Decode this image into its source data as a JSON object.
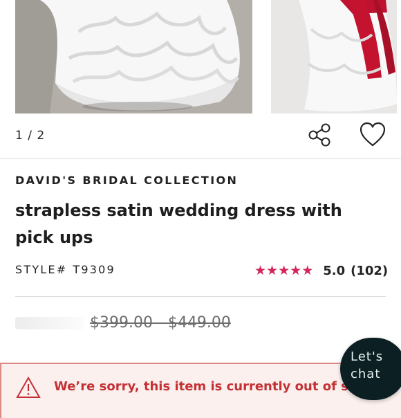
{
  "gallery": {
    "counter": "1 / 2",
    "main_photo": "wedding-dress-photo",
    "next_photo": "wedding-dress-back-photo",
    "share_icon": "share-icon",
    "favorite_icon": "heart-icon"
  },
  "product": {
    "brand": "DAVID'S BRIDAL COLLECTION",
    "title": "strapless satin wedding dress with pick ups",
    "style_label": "STYLE#",
    "style_value": "T9309",
    "rating_value": "5.0",
    "rating_count": "(102)",
    "stars": 5,
    "price": "$399.00 - $449.00"
  },
  "alert": {
    "message": "We’re sorry, this item is currently out of stock.",
    "icon": "warning-icon"
  },
  "chat": {
    "line1": "Let's",
    "line2": "chat"
  },
  "colors": {
    "star": "#d4245a",
    "alert_text": "#c43134",
    "alert_background": "#fbf0ee",
    "chat_background": "#0c1f22"
  }
}
